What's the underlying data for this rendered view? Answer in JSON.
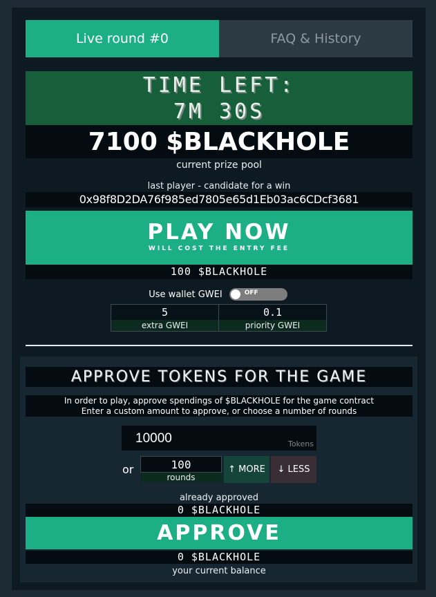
{
  "tabs": [
    {
      "label": "Live round #0"
    },
    {
      "label": "FAQ & History"
    }
  ],
  "timer": {
    "label": "TIME LEFT:",
    "value": "7M 30S"
  },
  "prize": {
    "amount": "7100 $BLACKHOLE",
    "caption": "current prize pool"
  },
  "last_player": {
    "caption": "last player - candidate for a win",
    "address": "0x98f8D2DA76f985ed7805e65d1Eb03ac6CDcf3681"
  },
  "play": {
    "label": "PLAY NOW",
    "sub": "WILL COST THE ENTRY FEE",
    "fee": "100 $BLACKHOLE"
  },
  "gwei": {
    "wallet_label": "Use wallet GWEI",
    "toggle_state": "OFF",
    "extra_value": "5",
    "extra_label": "extra GWEI",
    "priority_value": "0.1",
    "priority_label": "priority GWEI"
  },
  "approve": {
    "title": "APPROVE TOKENS FOR THE GAME",
    "instruction_1": "In order to play, approve spendings of $BLACKHOLE for the game contract",
    "instruction_2": "Enter a custom amount to approve, or choose a number of rounds",
    "tokens_value": "10000",
    "tokens_unit": "Tokens",
    "or": "or",
    "rounds_value": "100",
    "rounds_label": "rounds",
    "more_label": "↑ MORE",
    "less_label": "↓ LESS",
    "approved_caption": "already approved",
    "approved_value": "0 $BLACKHOLE",
    "button_label": "APPROVE",
    "balance_value": "0 $BLACKHOLE",
    "balance_caption": "your current balance"
  },
  "colors": {
    "accent": "#1cae84",
    "timer_bg": "#175e3a",
    "panel_bg": "#0d1a22",
    "page_bg": "#1c2b34"
  }
}
